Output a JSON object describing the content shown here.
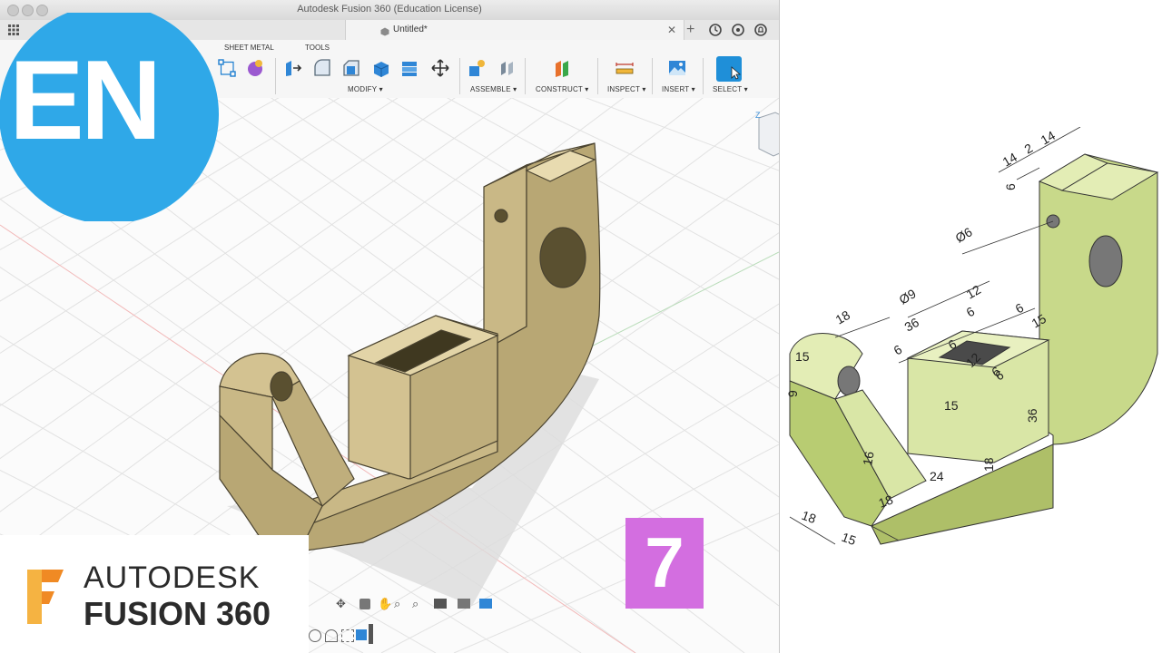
{
  "window": {
    "title": "Autodesk Fusion 360 (Education License)",
    "document_tab": "Untitled*"
  },
  "toolbar": {
    "tabs": [
      "SHEET METAL",
      "TOOLS"
    ],
    "groups": [
      "MODIFY ▾",
      "ASSEMBLE ▾",
      "CONSTRUCT ▾",
      "INSPECT ▾",
      "INSERT ▾",
      "SELECT ▾"
    ]
  },
  "overlay": {
    "language_badge": "EN",
    "episode_number": "7",
    "brand_line1": "AUTODESK",
    "brand_line2": "FUSION 360"
  },
  "drawing": {
    "dimensions": [
      "14",
      "2",
      "14",
      "6",
      "Ø6",
      "Ø9",
      "18",
      "12",
      "36",
      "6",
      "6",
      "6",
      "15",
      "15",
      "9",
      "6",
      "6",
      "12",
      "6",
      "15",
      "36",
      "16",
      "24",
      "18",
      "18",
      "18",
      "15"
    ]
  },
  "colors": {
    "part_fill": "#d8c898",
    "drawing_fill": "#d9e6a6",
    "badge_blue": "#2fa8e8",
    "badge_purple": "#d36ee0"
  }
}
